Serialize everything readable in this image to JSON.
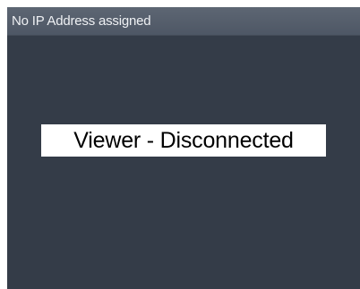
{
  "viewer": {
    "header_text": "No IP Address assigned",
    "status_text": "Viewer - Disconnected"
  }
}
